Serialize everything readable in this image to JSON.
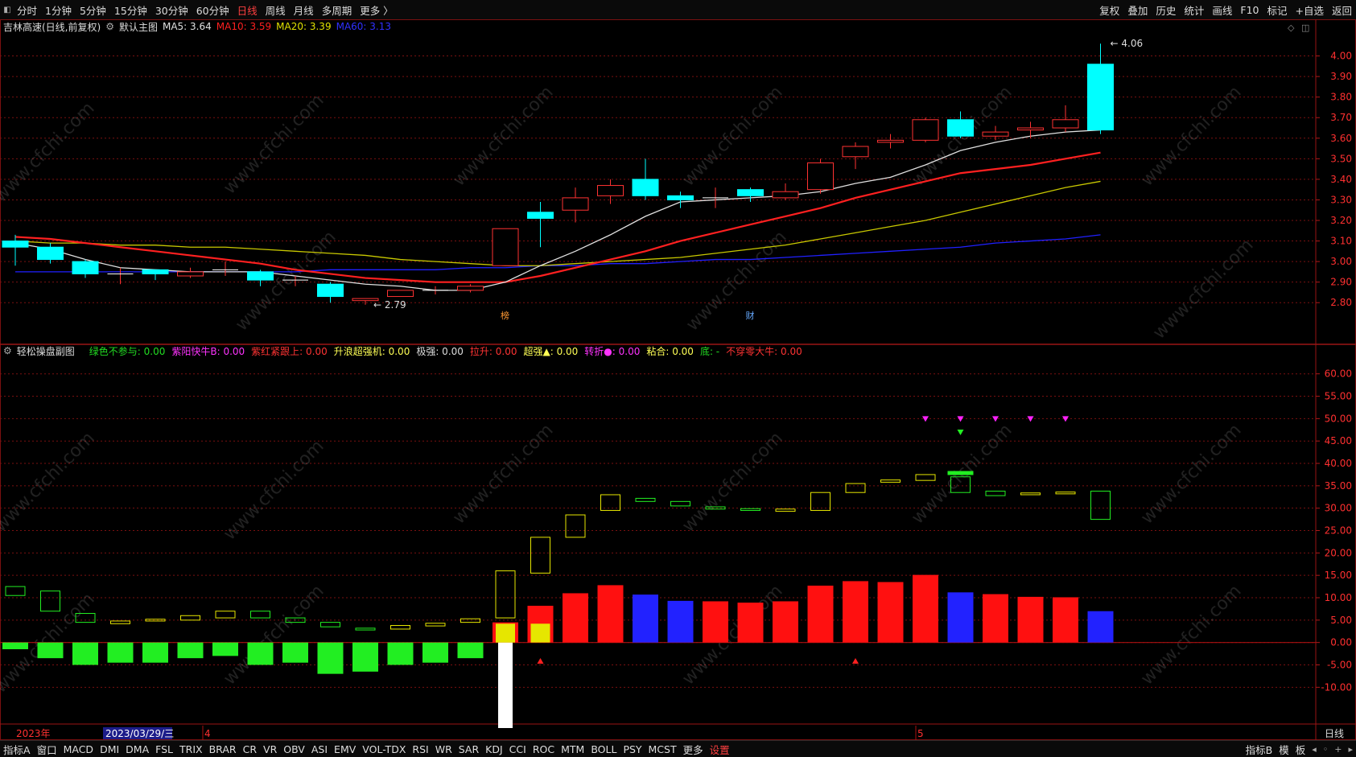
{
  "toolbar": {
    "left": [
      "分时",
      "1分钟",
      "5分钟",
      "15分钟",
      "30分钟",
      "60分钟",
      "日线",
      "周线",
      "月线",
      "多周期",
      "更多 〉"
    ],
    "active_index": 6,
    "right": [
      "复权",
      "叠加",
      "历史",
      "统计",
      "画线",
      "F10",
      "标记",
      "+自选",
      "返回"
    ]
  },
  "main_legend": {
    "stock": "吉林高速(日线,前复权)",
    "title": "默认主图",
    "ma5": "MA5: 3.64",
    "ma10": "MA10: 3.59",
    "ma20": "MA20: 3.39",
    "ma60": "MA60: 3.13"
  },
  "sub_legend": {
    "title": "轻松操盘副图",
    "items": [
      {
        "text": "绿色不参与: 0.00",
        "color": "#22dd22"
      },
      {
        "text": "紫阳快牛B: 0.00",
        "color": "#ff33ff"
      },
      {
        "text": "紫红紧跟上: 0.00",
        "color": "#ff3333"
      },
      {
        "text": "升浪超强机: 0.00",
        "color": "#ffff55"
      },
      {
        "text": "极强: 0.00",
        "color": "#dddddd"
      },
      {
        "text": "拉升: 0.00",
        "color": "#ff3333"
      },
      {
        "text": "超强▲: 0.00",
        "color": "#ffff55"
      },
      {
        "text": "转折●: 0.00",
        "color": "#ff33ff"
      },
      {
        "text": "粘合: 0.00",
        "color": "#ffff55"
      },
      {
        "text": "底: -",
        "color": "#22dd22"
      },
      {
        "text": "不穿零大牛: 0.00",
        "color": "#ff3333"
      }
    ]
  },
  "colors": {
    "up": "#ff3232",
    "down": "#00ffff",
    "ma5": "#e0e0e0",
    "ma10": "#ff2020",
    "ma20": "#c8c800",
    "ma60": "#2020ff",
    "grid": "#7a1010"
  },
  "chart_data": [
    {
      "type": "candlestick",
      "title": "默认主图",
      "ylim": [
        2.75,
        4.1
      ],
      "yticks": [
        "4.00",
        "3.90",
        "3.80",
        "3.70",
        "3.60",
        "3.50",
        "3.40",
        "3.30",
        "3.20",
        "3.10",
        "3.00",
        "2.90",
        "2.80"
      ],
      "candles": [
        {
          "o": 3.1,
          "c": 3.07,
          "h": 3.13,
          "l": 2.98
        },
        {
          "o": 3.07,
          "c": 3.01,
          "h": 3.09,
          "l": 2.99
        },
        {
          "o": 3.0,
          "c": 2.94,
          "h": 3.01,
          "l": 2.92
        },
        {
          "o": 2.94,
          "c": 2.94,
          "h": 2.97,
          "l": 2.89
        },
        {
          "o": 2.96,
          "c": 2.94,
          "h": 2.96,
          "l": 2.91
        },
        {
          "o": 2.93,
          "c": 2.95,
          "h": 2.97,
          "l": 2.92
        },
        {
          "o": 2.96,
          "c": 2.96,
          "h": 3.0,
          "l": 2.93
        },
        {
          "o": 2.95,
          "c": 2.91,
          "h": 2.96,
          "l": 2.88
        },
        {
          "o": 2.91,
          "c": 2.91,
          "h": 2.93,
          "l": 2.88
        },
        {
          "o": 2.89,
          "c": 2.83,
          "h": 2.9,
          "l": 2.8
        },
        {
          "o": 2.81,
          "c": 2.82,
          "h": 2.82,
          "l": 2.79
        },
        {
          "o": 2.83,
          "c": 2.86,
          "h": 2.86,
          "l": 2.83
        },
        {
          "o": 2.86,
          "c": 2.86,
          "h": 2.88,
          "l": 2.84
        },
        {
          "o": 2.86,
          "c": 2.88,
          "h": 2.89,
          "l": 2.85
        },
        {
          "o": 2.98,
          "c": 3.16,
          "h": 3.16,
          "l": 2.98
        },
        {
          "o": 3.24,
          "c": 3.21,
          "h": 3.29,
          "l": 3.07
        },
        {
          "o": 3.25,
          "c": 3.31,
          "h": 3.36,
          "l": 3.19
        },
        {
          "o": 3.32,
          "c": 3.37,
          "h": 3.4,
          "l": 3.28
        },
        {
          "o": 3.4,
          "c": 3.32,
          "h": 3.5,
          "l": 3.3
        },
        {
          "o": 3.32,
          "c": 3.3,
          "h": 3.34,
          "l": 3.26
        },
        {
          "o": 3.31,
          "c": 3.31,
          "h": 3.36,
          "l": 3.26
        },
        {
          "o": 3.35,
          "c": 3.32,
          "h": 3.36,
          "l": 3.29
        },
        {
          "o": 3.31,
          "c": 3.34,
          "h": 3.38,
          "l": 3.3
        },
        {
          "o": 3.35,
          "c": 3.48,
          "h": 3.5,
          "l": 3.33
        },
        {
          "o": 3.51,
          "c": 3.56,
          "h": 3.58,
          "l": 3.45
        },
        {
          "o": 3.58,
          "c": 3.59,
          "h": 3.62,
          "l": 3.55
        },
        {
          "o": 3.59,
          "c": 3.69,
          "h": 3.7,
          "l": 3.58
        },
        {
          "o": 3.69,
          "c": 3.61,
          "h": 3.73,
          "l": 3.6
        },
        {
          "o": 3.61,
          "c": 3.63,
          "h": 3.66,
          "l": 3.59
        },
        {
          "o": 3.64,
          "c": 3.65,
          "h": 3.68,
          "l": 3.6
        },
        {
          "o": 3.65,
          "c": 3.69,
          "h": 3.76,
          "l": 3.63
        },
        {
          "o": 3.96,
          "c": 3.64,
          "h": 4.06,
          "l": 3.62
        }
      ],
      "ma5": [
        3.09,
        3.06,
        3.01,
        2.97,
        2.96,
        2.95,
        2.95,
        2.95,
        2.93,
        2.91,
        2.89,
        2.88,
        2.86,
        2.86,
        2.9,
        2.98,
        3.05,
        3.13,
        3.22,
        3.29,
        3.3,
        3.31,
        3.32,
        3.34,
        3.38,
        3.41,
        3.47,
        3.54,
        3.58,
        3.61,
        3.63,
        3.64
      ],
      "ma10": [
        3.12,
        3.11,
        3.09,
        3.07,
        3.05,
        3.03,
        3.01,
        2.99,
        2.96,
        2.94,
        2.92,
        2.91,
        2.9,
        2.9,
        2.9,
        2.93,
        2.97,
        3.01,
        3.05,
        3.1,
        3.14,
        3.18,
        3.22,
        3.26,
        3.31,
        3.35,
        3.39,
        3.43,
        3.45,
        3.47,
        3.5,
        3.53,
        3.59
      ],
      "ma20": [
        3.1,
        3.09,
        3.09,
        3.08,
        3.08,
        3.07,
        3.07,
        3.06,
        3.05,
        3.04,
        3.03,
        3.01,
        3.0,
        2.99,
        2.98,
        2.98,
        2.99,
        3.0,
        3.01,
        3.02,
        3.04,
        3.06,
        3.08,
        3.11,
        3.14,
        3.17,
        3.2,
        3.24,
        3.28,
        3.32,
        3.36,
        3.39
      ],
      "ma60": [
        2.95,
        2.95,
        2.95,
        2.95,
        2.95,
        2.95,
        2.95,
        2.95,
        2.95,
        2.96,
        2.96,
        2.96,
        2.96,
        2.97,
        2.97,
        2.98,
        2.98,
        2.99,
        2.99,
        3.0,
        3.01,
        3.01,
        3.02,
        3.03,
        3.04,
        3.05,
        3.06,
        3.07,
        3.09,
        3.1,
        3.11,
        3.13
      ],
      "annotations": {
        "high": "4.06",
        "low": "2.79",
        "marker_a": "榜",
        "marker_b": "财"
      }
    },
    {
      "type": "bar",
      "title": "轻松操盘副图",
      "ylim": [
        -20,
        63
      ],
      "yticks": [
        "60.00",
        "55.00",
        "50.00",
        "45.00",
        "40.00",
        "35.00",
        "30.00",
        "25.00",
        "20.00",
        "15.00",
        "10.00",
        "5.00",
        "0.00",
        "-5.00",
        "-10.00"
      ],
      "bars": [
        -1.5,
        -3.5,
        -5,
        -4.5,
        -4.5,
        -3.5,
        -3,
        -5,
        -4.5,
        -7,
        -6.5,
        -5,
        -4.5,
        -3.5,
        4.5,
        8.2,
        11,
        12.8,
        10.7,
        9.3,
        9.2,
        8.9,
        9.2,
        12.7,
        13.7,
        13.5,
        15.1,
        11.2,
        10.8,
        10.2,
        10.1,
        7
      ],
      "bar_colors": [
        "g",
        "g",
        "g",
        "g",
        "g",
        "g",
        "g",
        "g",
        "g",
        "g",
        "g",
        "g",
        "g",
        "g",
        "r",
        "r",
        "r",
        "r",
        "b",
        "b",
        "r",
        "r",
        "r",
        "r",
        "r",
        "r",
        "r",
        "b",
        "r",
        "r",
        "r",
        "b"
      ],
      "boxes": [
        {
          "lo": 10.5,
          "hi": 12.5,
          "c": "g"
        },
        {
          "lo": 7,
          "hi": 11.5,
          "c": "g"
        },
        {
          "lo": 4.5,
          "hi": 6.5,
          "c": "g"
        },
        {
          "lo": 4.2,
          "hi": 4.8,
          "c": "y"
        },
        {
          "lo": 4.8,
          "hi": 5.2,
          "c": "y"
        },
        {
          "lo": 5,
          "hi": 6,
          "c": "y"
        },
        {
          "lo": 5.5,
          "hi": 7,
          "c": "y"
        },
        {
          "lo": 5.5,
          "hi": 7,
          "c": "g"
        },
        {
          "lo": 4.5,
          "hi": 5.5,
          "c": "g"
        },
        {
          "lo": 3.5,
          "hi": 4.5,
          "c": "g"
        },
        {
          "lo": 2.8,
          "hi": 3.2,
          "c": "g"
        },
        {
          "lo": 3,
          "hi": 3.8,
          "c": "y"
        },
        {
          "lo": 3.7,
          "hi": 4.3,
          "c": "y"
        },
        {
          "lo": 4.5,
          "hi": 5.3,
          "c": "y"
        },
        {
          "lo": 5.5,
          "hi": 16,
          "c": "y"
        },
        {
          "lo": 15.5,
          "hi": 23.5,
          "c": "y"
        },
        {
          "lo": 23.5,
          "hi": 28.5,
          "c": "y"
        },
        {
          "lo": 29.5,
          "hi": 33,
          "c": "y"
        },
        {
          "lo": 31.5,
          "hi": 32.2,
          "c": "g"
        },
        {
          "lo": 30.5,
          "hi": 31.5,
          "c": "g"
        },
        {
          "lo": 29.8,
          "hi": 30.3,
          "c": "g"
        },
        {
          "lo": 29.5,
          "hi": 29.9,
          "c": "g"
        },
        {
          "lo": 29.3,
          "hi": 29.8,
          "c": "y"
        },
        {
          "lo": 29.5,
          "hi": 33.5,
          "c": "y"
        },
        {
          "lo": 33.5,
          "hi": 35.5,
          "c": "y"
        },
        {
          "lo": 35.8,
          "hi": 36.3,
          "c": "y"
        },
        {
          "lo": 36.2,
          "hi": 37.5,
          "c": "y"
        },
        {
          "lo": 33.5,
          "hi": 37,
          "c": "g"
        },
        {
          "lo": 32.8,
          "hi": 33.8,
          "c": "g"
        },
        {
          "lo": 33,
          "hi": 33.4,
          "c": "y"
        },
        {
          "lo": 33.2,
          "hi": 33.6,
          "c": "y"
        },
        {
          "lo": 27.5,
          "hi": 33.8,
          "c": "g"
        }
      ],
      "signals": {
        "tri_down_purple": [
          26,
          27,
          28,
          29,
          30
        ],
        "tri_down_green": [
          27
        ],
        "tri_up_red": [
          15,
          24
        ],
        "flat_green_bar": [
          27
        ]
      }
    }
  ],
  "time_axis": {
    "year": "2023年",
    "date": "2023/03/29/三",
    "month4": "4",
    "month5": "5",
    "period": "日线"
  },
  "bottom_tabs": [
    "指标A",
    "窗口",
    "MACD",
    "DMI",
    "DMA",
    "FSL",
    "TRIX",
    "BRAR",
    "CR",
    "VR",
    "OBV",
    "ASI",
    "EMV",
    "VOL-TDX",
    "RSI",
    "WR",
    "SAR",
    "KDJ",
    "CCI",
    "ROC",
    "MTM",
    "BOLL",
    "PSY",
    "MCST",
    "更多",
    "设置"
  ],
  "bottom_right": [
    "指标B",
    "模",
    "板"
  ],
  "watermark": "www.cfchi.com"
}
